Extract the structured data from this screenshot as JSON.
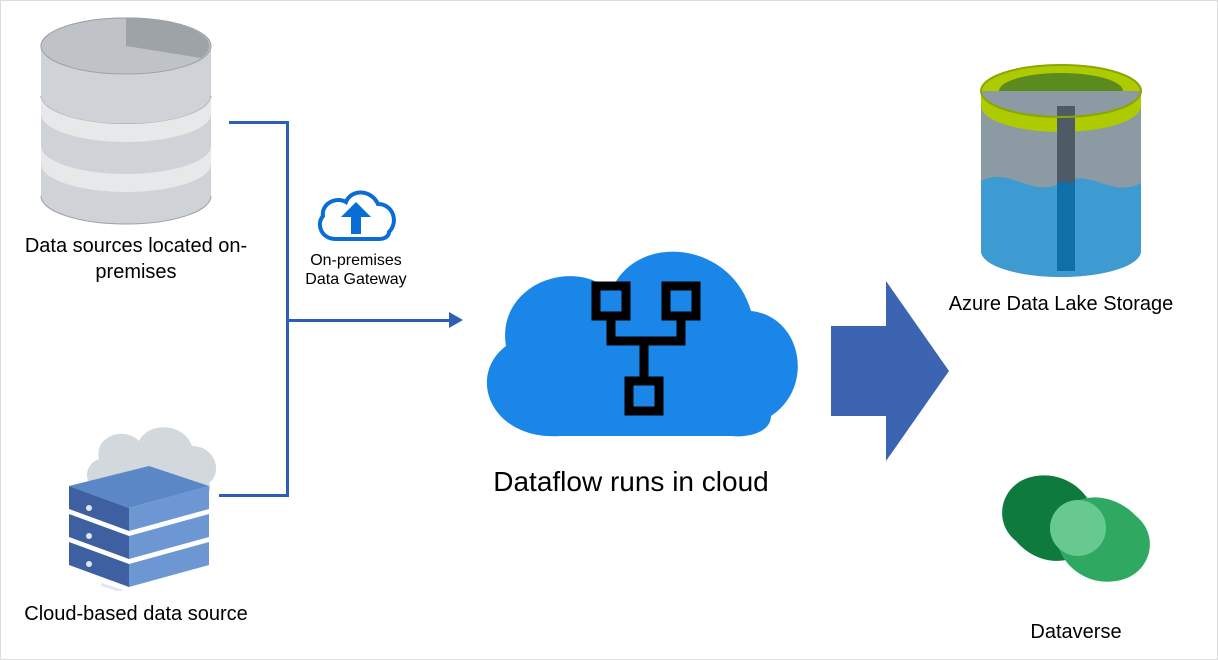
{
  "labels": {
    "on_prem_source": "Data sources located on-premises",
    "gateway": "On-premises Data Gateway",
    "cloud_source": "Cloud-based data source",
    "dataflow": "Dataflow runs in cloud",
    "adls": "Azure Data Lake Storage",
    "dataverse": "Dataverse"
  }
}
